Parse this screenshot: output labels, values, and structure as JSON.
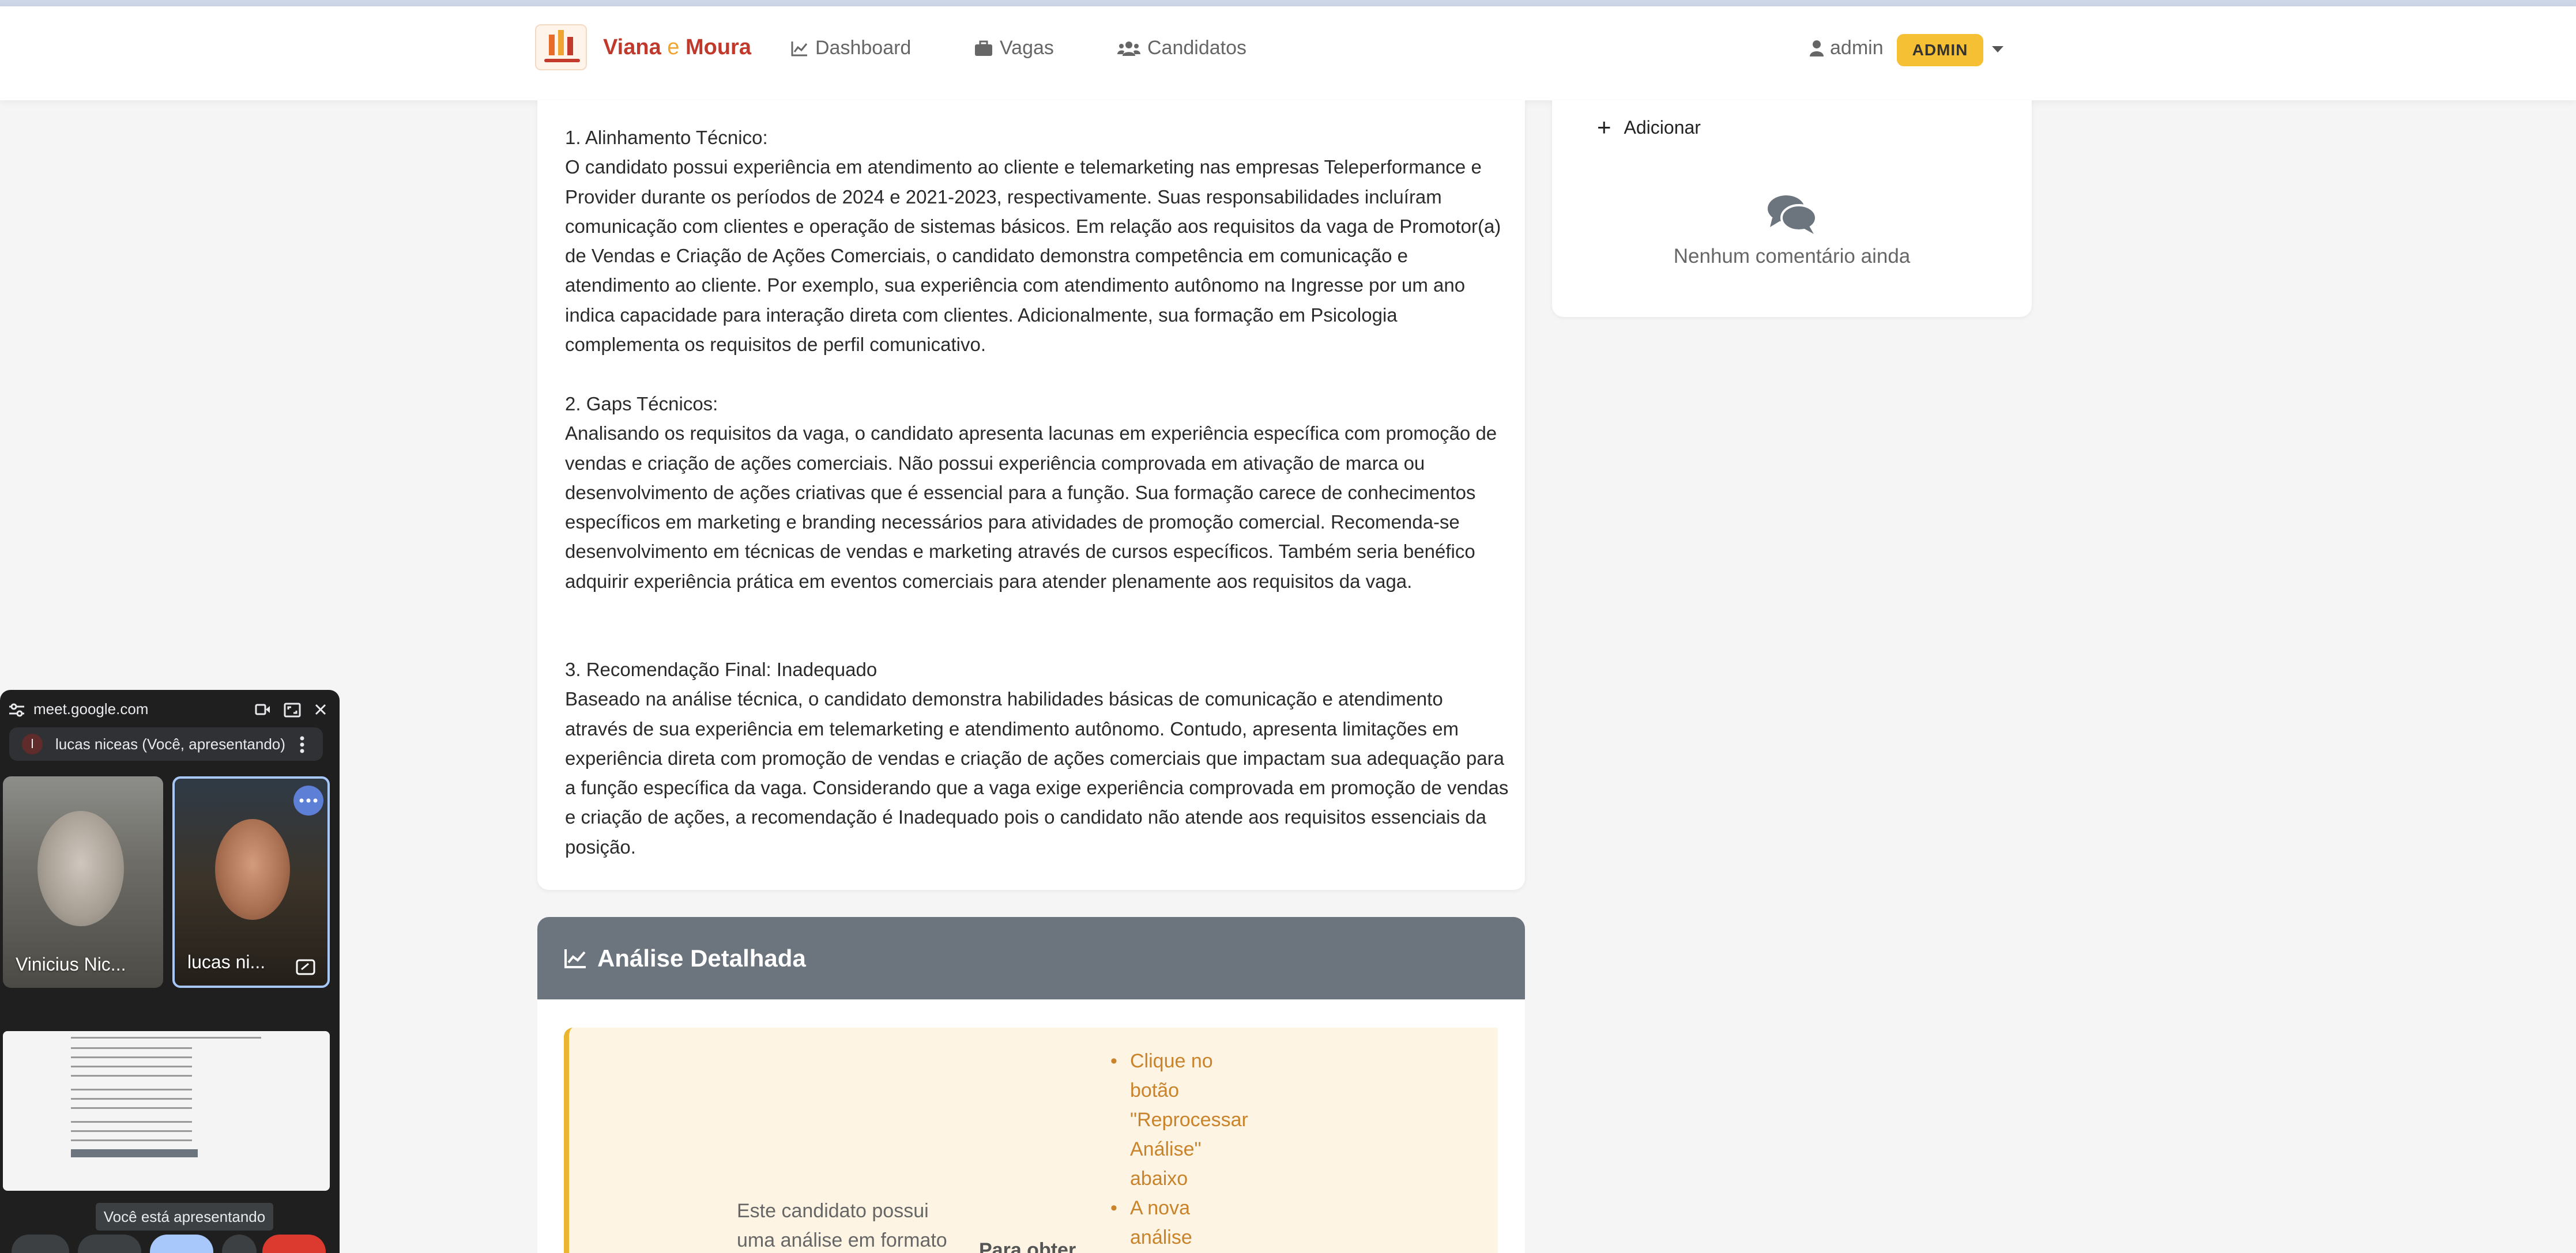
{
  "brand": {
    "name_part1": "Viana",
    "name_connector": "e",
    "name_part2": "Moura"
  },
  "nav": {
    "dashboard": "Dashboard",
    "vagas": "Vagas",
    "candidatos": "Candidatos"
  },
  "user": {
    "name": "admin",
    "role_badge": "ADMIN"
  },
  "analysis": {
    "section1_title": "1. Alinhamento Técnico:",
    "section1_body": "O candidato possui experiência em atendimento ao cliente e telemarketing nas empresas Teleperformance e Provider durante os períodos de 2024 e 2021-2023, respectivamente. Suas responsabilidades incluíram comunicação com clientes e operação de sistemas básicos. Em relação aos requisitos da vaga de Promotor(a) de Vendas e Criação de Ações Comerciais, o candidato demonstra competência em comunicação e atendimento ao cliente. Por exemplo, sua experiência com atendimento autônomo na Ingresse por um ano indica capacidade para interação direta com clientes. Adicionalmente, sua formação em Psicologia complementa os requisitos de perfil comunicativo.",
    "section2_title": "2. Gaps Técnicos:",
    "section2_body": "Analisando os requisitos da vaga, o candidato apresenta lacunas em experiência específica com promoção de vendas e criação de ações comerciais. Não possui experiência comprovada em ativação de marca ou desenvolvimento de ações criativas que é essencial para a função. Sua formação carece de conhecimentos específicos em marketing e branding necessários para atividades de promoção comercial. Recomenda-se desenvolvimento em técnicas de vendas e marketing através de cursos específicos. Também seria benéfico adquirir experiência prática em eventos comerciais para atender plenamente aos requisitos da vaga.",
    "section3_title": "3. Recomendação Final: Inadequado",
    "section3_body": "Baseado na análise técnica, o candidato demonstra habilidades básicas de comunicação e atendimento através de sua experiência em telemarketing e atendimento autônomo. Contudo, apresenta limitações em experiência direta com promoção de vendas e criação de ações comerciais que impactam sua adequação para a função específica da vaga. Considerando que a vaga exige experiência comprovada em promoção de vendas e criação de ações, a recomendação é Inadequado pois o candidato não atende aos requisitos essenciais da posição."
  },
  "comments": {
    "add_label": "Adicionar",
    "empty_text": "Nenhum comentário ainda"
  },
  "detailed": {
    "title": "Análise Detalhada",
    "notice_text": "Este candidato possui uma análise em formato",
    "notice_bold": "Para obter",
    "steps": [
      "Clique no",
      "botão",
      "\"Reprocessar",
      "Análise\"",
      "abaixo",
      "A nova",
      "análise"
    ]
  },
  "meet": {
    "url": "meet.google.com",
    "avatar_letter": "l",
    "presenting_label": "lucas niceas (Você, apresentando)",
    "participant1": "Vinicius Nic...",
    "participant2": "lucas ni...",
    "tooltip": "Você está apresentando"
  },
  "colors": {
    "brand_red": "#c0392b",
    "brand_orange": "#f0a431",
    "admin_badge": "#f5c033",
    "detail_header": "#6c757d",
    "warning_bg": "#fdf4e3",
    "warning_text": "#c9832a"
  }
}
